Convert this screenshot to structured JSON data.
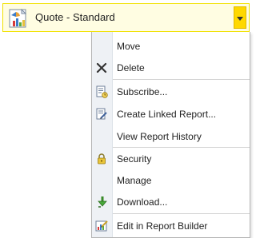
{
  "report": {
    "title": "Quote - Standard",
    "icon": "report-chart-icon"
  },
  "menu": {
    "items": [
      {
        "label": "Move",
        "icon": ""
      },
      {
        "label": "Delete",
        "icon": "delete-x-icon"
      },
      {
        "label": "Subscribe...",
        "icon": "subscribe-icon"
      },
      {
        "label": "Create Linked Report...",
        "icon": "linked-report-icon"
      },
      {
        "label": "View Report History",
        "icon": ""
      },
      {
        "label": "Security",
        "icon": "lock-icon"
      },
      {
        "label": "Manage",
        "icon": ""
      },
      {
        "label": "Download...",
        "icon": "download-arrow-icon"
      },
      {
        "label": "Edit in Report Builder",
        "icon": "report-builder-icon"
      }
    ]
  },
  "colors": {
    "header_background": "#fffde2",
    "header_border": "#f1e100",
    "dropdown_button": "#ffd800",
    "menu_gutter": "#eef1f5"
  }
}
